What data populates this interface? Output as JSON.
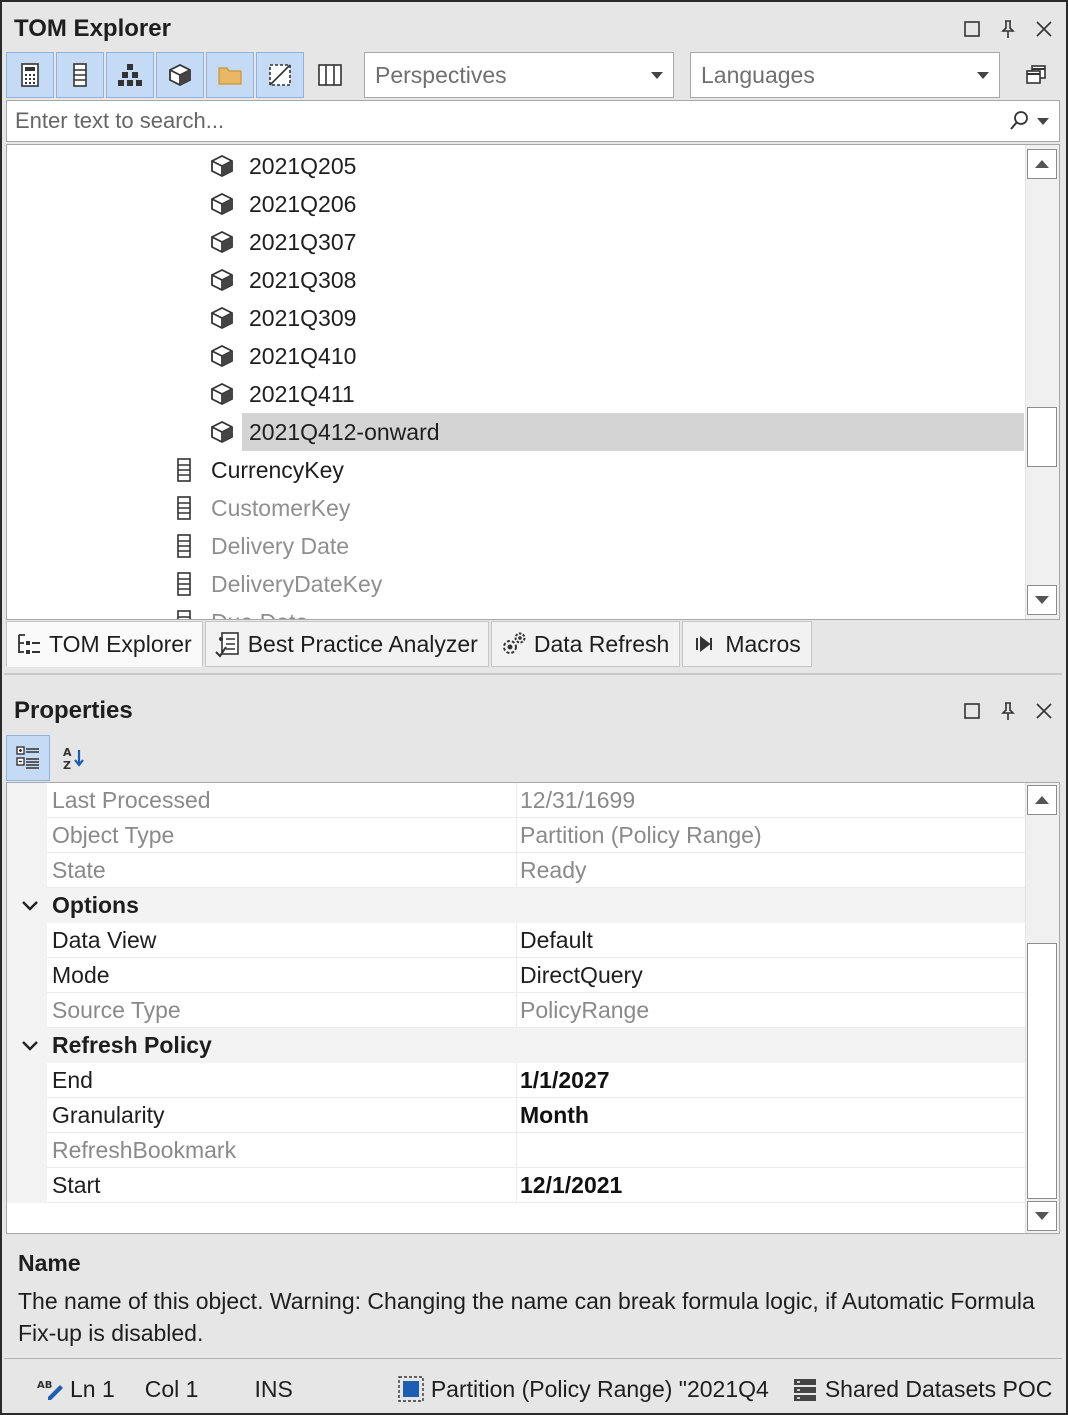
{
  "tom_explorer": {
    "title": "TOM Explorer",
    "perspectives_placeholder": "Perspectives",
    "languages_placeholder": "Languages",
    "search_placeholder": "Enter text to search...",
    "partitions": [
      {
        "label": "2021Q205"
      },
      {
        "label": "2021Q206"
      },
      {
        "label": "2021Q307"
      },
      {
        "label": "2021Q308"
      },
      {
        "label": "2021Q309"
      },
      {
        "label": "2021Q410"
      },
      {
        "label": "2021Q411"
      },
      {
        "label": "2021Q412-onward",
        "selected": true
      }
    ],
    "columns": [
      {
        "label": "CurrencyKey",
        "hidden": false
      },
      {
        "label": "CustomerKey",
        "hidden": true
      },
      {
        "label": "Delivery Date",
        "hidden": true
      },
      {
        "label": "DeliveryDateKey",
        "hidden": true
      },
      {
        "label": "Due Date",
        "hidden": true
      }
    ],
    "tabs": [
      {
        "label": "TOM Explorer",
        "icon": "tree-icon",
        "active": true
      },
      {
        "label": "Best Practice Analyzer",
        "icon": "checklist-icon",
        "active": false
      },
      {
        "label": "Data Refresh",
        "icon": "gears-icon",
        "active": false
      },
      {
        "label": "Macros",
        "icon": "play-macro-icon",
        "active": false
      }
    ]
  },
  "properties": {
    "title": "Properties",
    "rows_top": [
      {
        "name": "Last Processed",
        "value": "12/31/1699"
      },
      {
        "name": "Object Type",
        "value": "Partition (Policy Range)"
      },
      {
        "name": "State",
        "value": "Ready"
      }
    ],
    "options": {
      "label": "Options",
      "rows": [
        {
          "name": "Data View",
          "value": "Default"
        },
        {
          "name": "Mode",
          "value": "DirectQuery"
        },
        {
          "name": "Source Type",
          "value": "PolicyRange"
        }
      ]
    },
    "refresh_policy": {
      "label": "Refresh Policy",
      "rows": [
        {
          "name": "End",
          "value": "1/1/2027"
        },
        {
          "name": "Granularity",
          "value": "Month"
        },
        {
          "name": "RefreshBookmark",
          "value": ""
        },
        {
          "name": "Start",
          "value": "12/1/2021"
        }
      ]
    },
    "description": {
      "title": "Name",
      "text": "The name of this object. Warning: Changing the name can break formula logic, if Automatic Formula Fix-up is disabled."
    }
  },
  "statusbar": {
    "ln": "Ln 1",
    "col": "Col 1",
    "mode": "INS",
    "selection": "Partition (Policy Range) \"2021Q4",
    "model": "Shared Datasets POC"
  },
  "colors": {
    "selection": "#d4d4d4",
    "active_button": "#c5dbf5",
    "hidden_text": "#8f8f8f"
  }
}
